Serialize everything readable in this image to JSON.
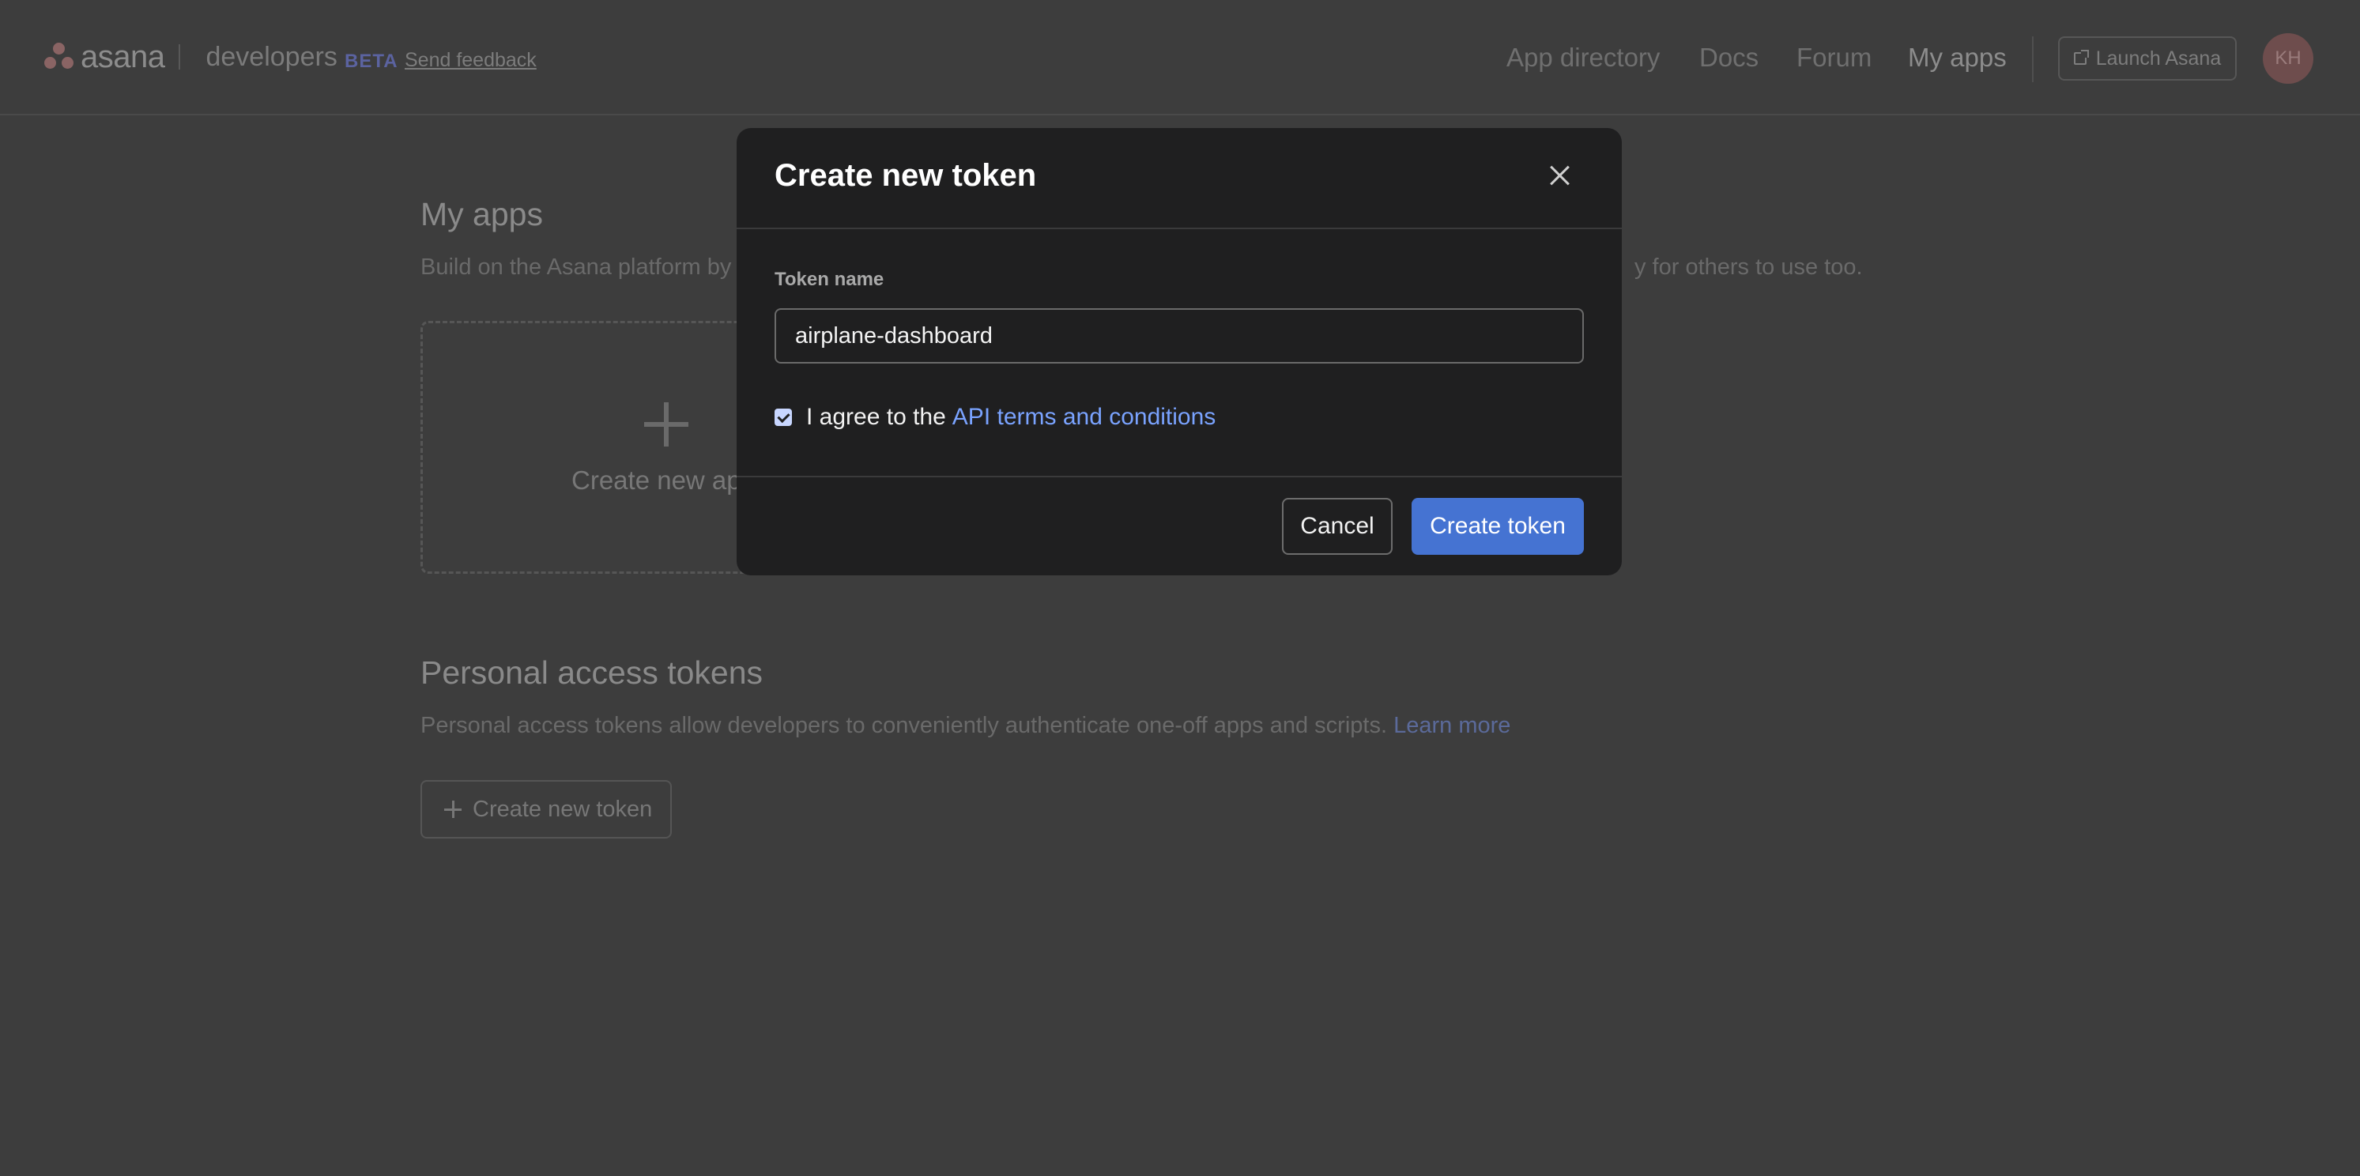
{
  "header": {
    "logo_text": "asana",
    "product_text": "developers",
    "beta_label": "BETA",
    "feedback_link": "Send feedback",
    "nav": [
      {
        "label": "App directory"
      },
      {
        "label": "Docs"
      },
      {
        "label": "Forum"
      },
      {
        "label": "My apps",
        "active": true
      }
    ],
    "launch_button": "Launch Asana",
    "avatar_initials": "KH"
  },
  "my_apps": {
    "title": "My apps",
    "description_left": "Build on the Asana platform by",
    "description_right": "y for others to use too.",
    "create_app_label": "Create new ap"
  },
  "tokens": {
    "title": "Personal access tokens",
    "description": "Personal access tokens allow developers to conveniently authenticate one-off apps and scripts.",
    "learn_more": "Learn more",
    "create_button": "Create new token"
  },
  "modal": {
    "title": "Create new token",
    "field_label": "Token name",
    "field_value": "airplane-dashboard",
    "agree_checked": true,
    "agree_text": "I agree to the",
    "agree_link": "API terms and conditions",
    "cancel_label": "Cancel",
    "submit_label": "Create token"
  },
  "colors": {
    "page_background": "#3d3d3d",
    "modal_background": "#1f1f20",
    "primary_button": "#4573d2",
    "link": "#7aa3ff"
  }
}
